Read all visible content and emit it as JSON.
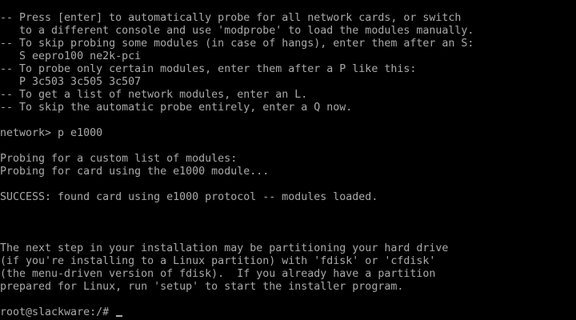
{
  "terminal": {
    "lines": [
      "-- Press [enter] to automatically probe for all network cards, or switch",
      "   to a different console and use 'modprobe' to load the modules manually.",
      "-- To skip probing some modules (in case of hangs), enter them after an S:",
      "   S eepro100 ne2k-pci",
      "-- To probe only certain modules, enter them after a P like this:",
      "   P 3c503 3c505 3c507",
      "-- To get a list of network modules, enter an L.",
      "-- To skip the automatic probe entirely, enter a Q now.",
      "",
      "network> p e1000",
      "",
      "Probing for a custom list of modules:",
      "Probing for card using the e1000 module...",
      "",
      "SUCCESS: found card using e1000 protocol -- modules loaded.",
      "",
      "",
      "",
      "The next step in your installation may be partitioning your hard drive",
      "(if you're installing to a Linux partition) with 'fdisk' or 'cfdisk'",
      "(the menu-driven version of fdisk).  If you already have a partition",
      "prepared for Linux, run 'setup' to start the installer program.",
      "",
      "root@slackware:/# "
    ],
    "foreground": "#aaaaaa",
    "background": "#000000"
  }
}
